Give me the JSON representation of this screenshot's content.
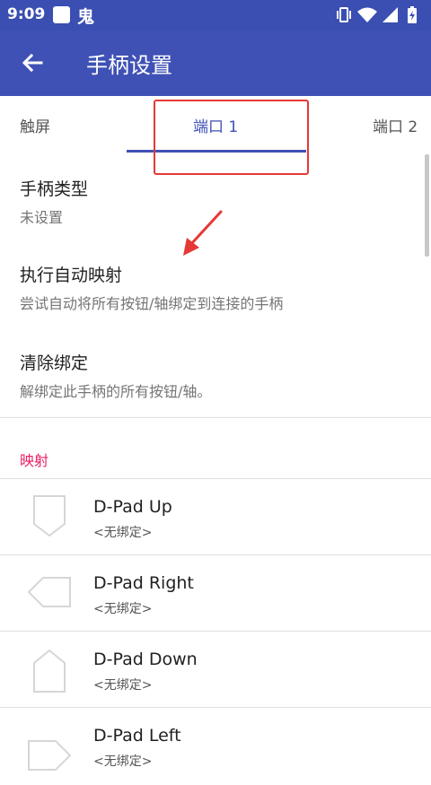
{
  "status_bar": {
    "time": "9:09",
    "notification_char": "鬼"
  },
  "toolbar": {
    "title": "手柄设置"
  },
  "tabs": [
    {
      "label": "触屏",
      "active": false
    },
    {
      "label": "端口 1",
      "active": true
    },
    {
      "label": "端口 2",
      "active": false
    }
  ],
  "settings": [
    {
      "title": "手柄类型",
      "subtitle": "未设置"
    },
    {
      "title": "执行自动映射",
      "subtitle": "尝试自动将所有按钮/轴绑定到连接的手柄"
    },
    {
      "title": "清除绑定",
      "subtitle": "解绑定此手柄的所有按钮/轴。"
    }
  ],
  "mapping_section": {
    "header": "映射",
    "items": [
      {
        "label": "D-Pad Up",
        "binding": "<无绑定>",
        "icon": "dpad-up-icon"
      },
      {
        "label": "D-Pad Right",
        "binding": "<无绑定>",
        "icon": "dpad-right-icon"
      },
      {
        "label": "D-Pad Down",
        "binding": "<无绑定>",
        "icon": "dpad-down-icon"
      },
      {
        "label": "D-Pad Left",
        "binding": "<无绑定>",
        "icon": "dpad-left-icon"
      }
    ]
  },
  "colors": {
    "primary": "#3f51b5",
    "status_bar": "#3a4fb1",
    "accent_pink": "#e91e63",
    "annotation_red": "#e53935"
  }
}
